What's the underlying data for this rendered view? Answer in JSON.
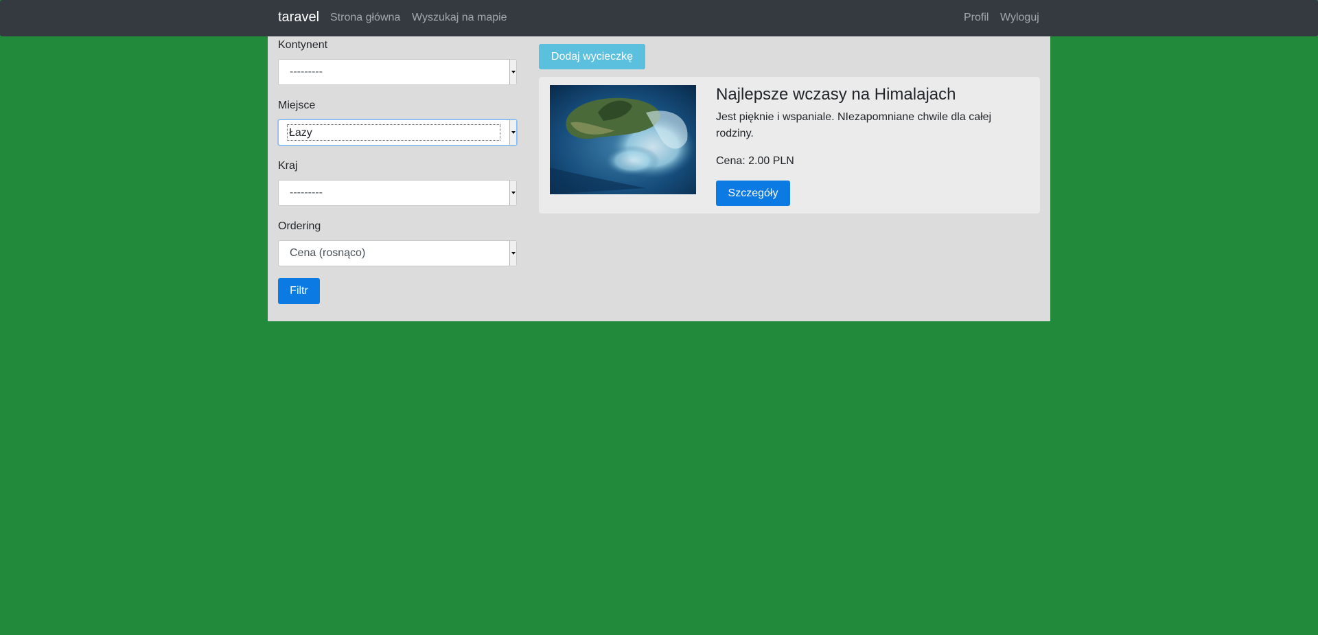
{
  "navbar": {
    "brand": "taravel",
    "links": [
      "Strona główna",
      "Wyszukaj na mapie"
    ],
    "right_links": [
      "Profil",
      "Wyloguj"
    ]
  },
  "filters": {
    "continent": {
      "label": "Kontynent",
      "value": "---------"
    },
    "place": {
      "label": "Miejsce",
      "value": "Łazy"
    },
    "country": {
      "label": "Kraj",
      "value": "---------"
    },
    "ordering": {
      "label": "Ordering",
      "value": "Cena (rosnąco)"
    },
    "submit_label": "Filtr"
  },
  "add_trip_label": "Dodaj wycieczkę",
  "trip": {
    "title": "Najlepsze wczasy na Himalajach",
    "description": "Jest pięknie i wspaniale. NIezapomniane chwile dla całej rodziny.",
    "price": "Cena: 2.00 PLN",
    "details_label": "Szczegóły",
    "image_icon": "island-aerial-photo"
  },
  "colors": {
    "page_bg": "#228a3b",
    "navbar_bg": "#343a40",
    "container_bg": "#dcdcdc",
    "primary": "#0b7ae3",
    "info": "#5bc0de"
  }
}
